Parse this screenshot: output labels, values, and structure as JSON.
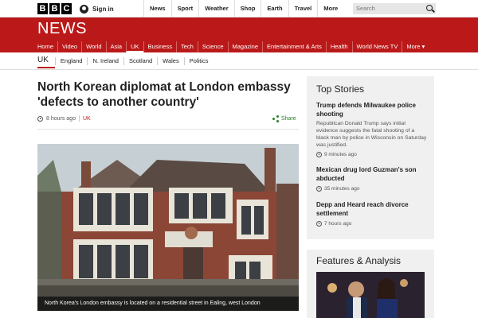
{
  "brand": {
    "logo_letters": [
      "B",
      "B",
      "C"
    ]
  },
  "topbar": {
    "signin_label": "Sign in",
    "nav": [
      "News",
      "Sport",
      "Weather",
      "Shop",
      "Earth",
      "Travel"
    ],
    "more_label": "More",
    "search_placeholder": "Search"
  },
  "masthead": {
    "title": "NEWS",
    "nav": [
      {
        "label": "Home",
        "active": false
      },
      {
        "label": "Video",
        "active": false
      },
      {
        "label": "World",
        "active": false
      },
      {
        "label": "Asia",
        "active": false
      },
      {
        "label": "UK",
        "active": true
      },
      {
        "label": "Business",
        "active": false
      },
      {
        "label": "Tech",
        "active": false
      },
      {
        "label": "Science",
        "active": false
      },
      {
        "label": "Magazine",
        "active": false
      },
      {
        "label": "Entertainment & Arts",
        "active": false
      },
      {
        "label": "Health",
        "active": false
      },
      {
        "label": "World News TV",
        "active": false
      },
      {
        "label": "More ▾",
        "active": false
      }
    ]
  },
  "subnav": {
    "current": "UK",
    "items": [
      "England",
      "N. Ireland",
      "Scotland",
      "Wales",
      "Politics"
    ]
  },
  "article": {
    "headline": "North Korean diplomat at London embassy 'defects to another country'",
    "time": "8 hours ago",
    "section": "UK",
    "share_label": "Share",
    "caption": "North Korea's London embassy is located on a residential street in Ealing, west London"
  },
  "top_stories": {
    "title": "Top Stories",
    "stories": [
      {
        "title": "Trump defends Milwaukee police shooting",
        "summary": "Republican Donald Trump says initial evidence suggests the fatal shooting of a black man by police in Wisconsin on Saturday was justified.",
        "time": "9 minutes ago"
      },
      {
        "title": "Mexican drug lord Guzman's son abducted",
        "summary": "",
        "time": "35 minutes ago"
      },
      {
        "title": "Depp and Heard reach divorce settlement",
        "summary": "",
        "time": "7 hours ago"
      }
    ]
  },
  "features": {
    "title": "Features & Analysis"
  },
  "colors": {
    "brand_red": "#bb1919",
    "share_green": "#2a7d2a",
    "panel_grey": "#f0f0f0"
  }
}
